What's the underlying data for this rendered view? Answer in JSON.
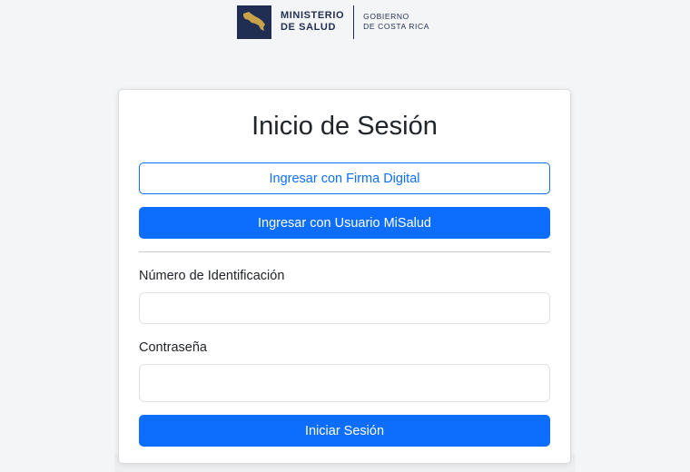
{
  "header": {
    "logo": {
      "emblem_icon": "costa-rica-map-icon",
      "ministry_line1": "MINISTERIO",
      "ministry_line2": "DE SALUD",
      "gov_line1": "GOBIERNO",
      "gov_line2": "DE COSTA RICA"
    }
  },
  "login": {
    "title": "Inicio de Sesión",
    "firma_digital_button": "Ingresar con Firma Digital",
    "misalud_button": "Ingresar con Usuario MiSalud",
    "id_label": "Número de Identificación",
    "id_value": "",
    "password_label": "Contraseña",
    "password_value": "",
    "submit_button": "Iniciar Sesión"
  },
  "colors": {
    "primary": "#0d6efd",
    "brand_navy": "#1f2e52",
    "background": "#f4f5f7"
  }
}
